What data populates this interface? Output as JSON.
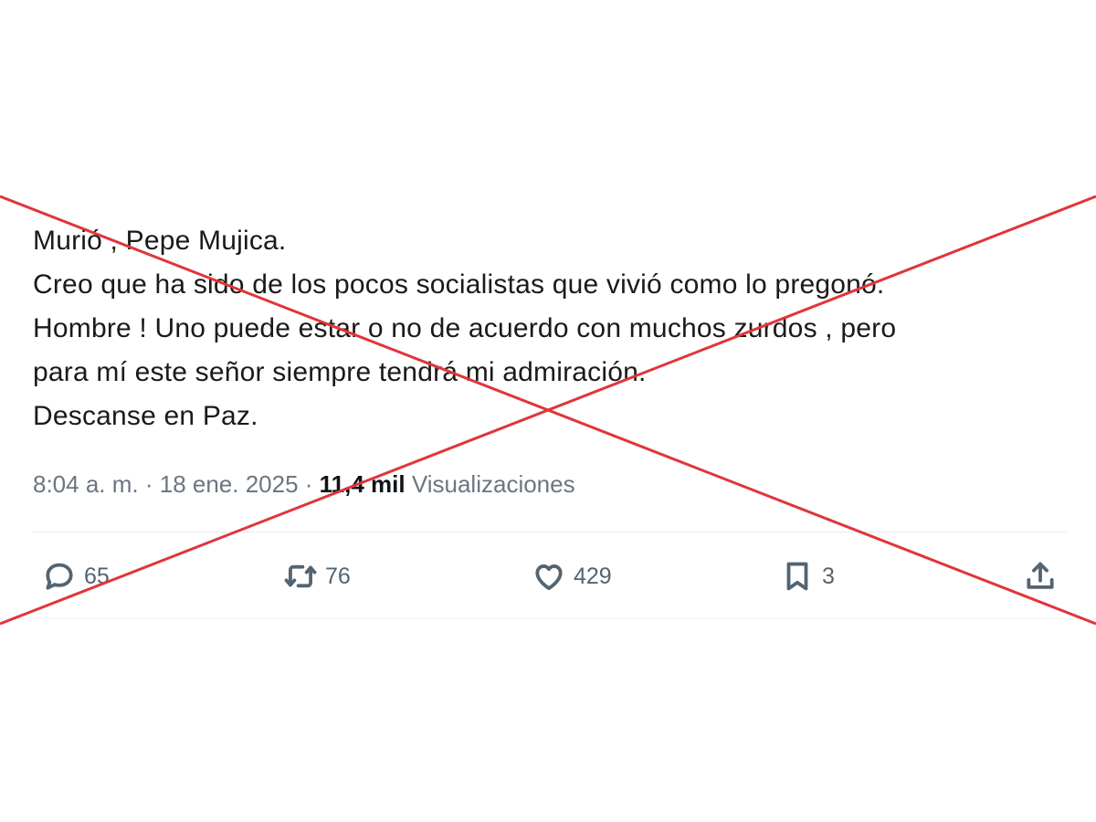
{
  "tweet": {
    "lines": [
      "Murió , Pepe Mujica.",
      "Creo que ha sido de los pocos socialistas que vivió como lo pregonó.",
      "Hombre ! Uno puede estar o no de acuerdo con muchos zurdos , pero",
      "para mí este señor siempre tendrá mi admiración.",
      "Descanse en Paz."
    ],
    "time": "8:04 a. m.",
    "separator": " · ",
    "date": "18 ene. 2025",
    "views_count": "11,4 mil",
    "views_label": "Visualizaciones"
  },
  "actions": {
    "reply": {
      "icon": "reply-icon",
      "count": "65"
    },
    "retweet": {
      "icon": "retweet-icon",
      "count": "76"
    },
    "like": {
      "icon": "heart-icon",
      "count": "429"
    },
    "bookmark": {
      "icon": "bookmark-icon",
      "count": "3"
    },
    "share": {
      "icon": "share-icon"
    }
  },
  "overlay": {
    "type": "red-x-cross",
    "color": "#e0353b"
  }
}
